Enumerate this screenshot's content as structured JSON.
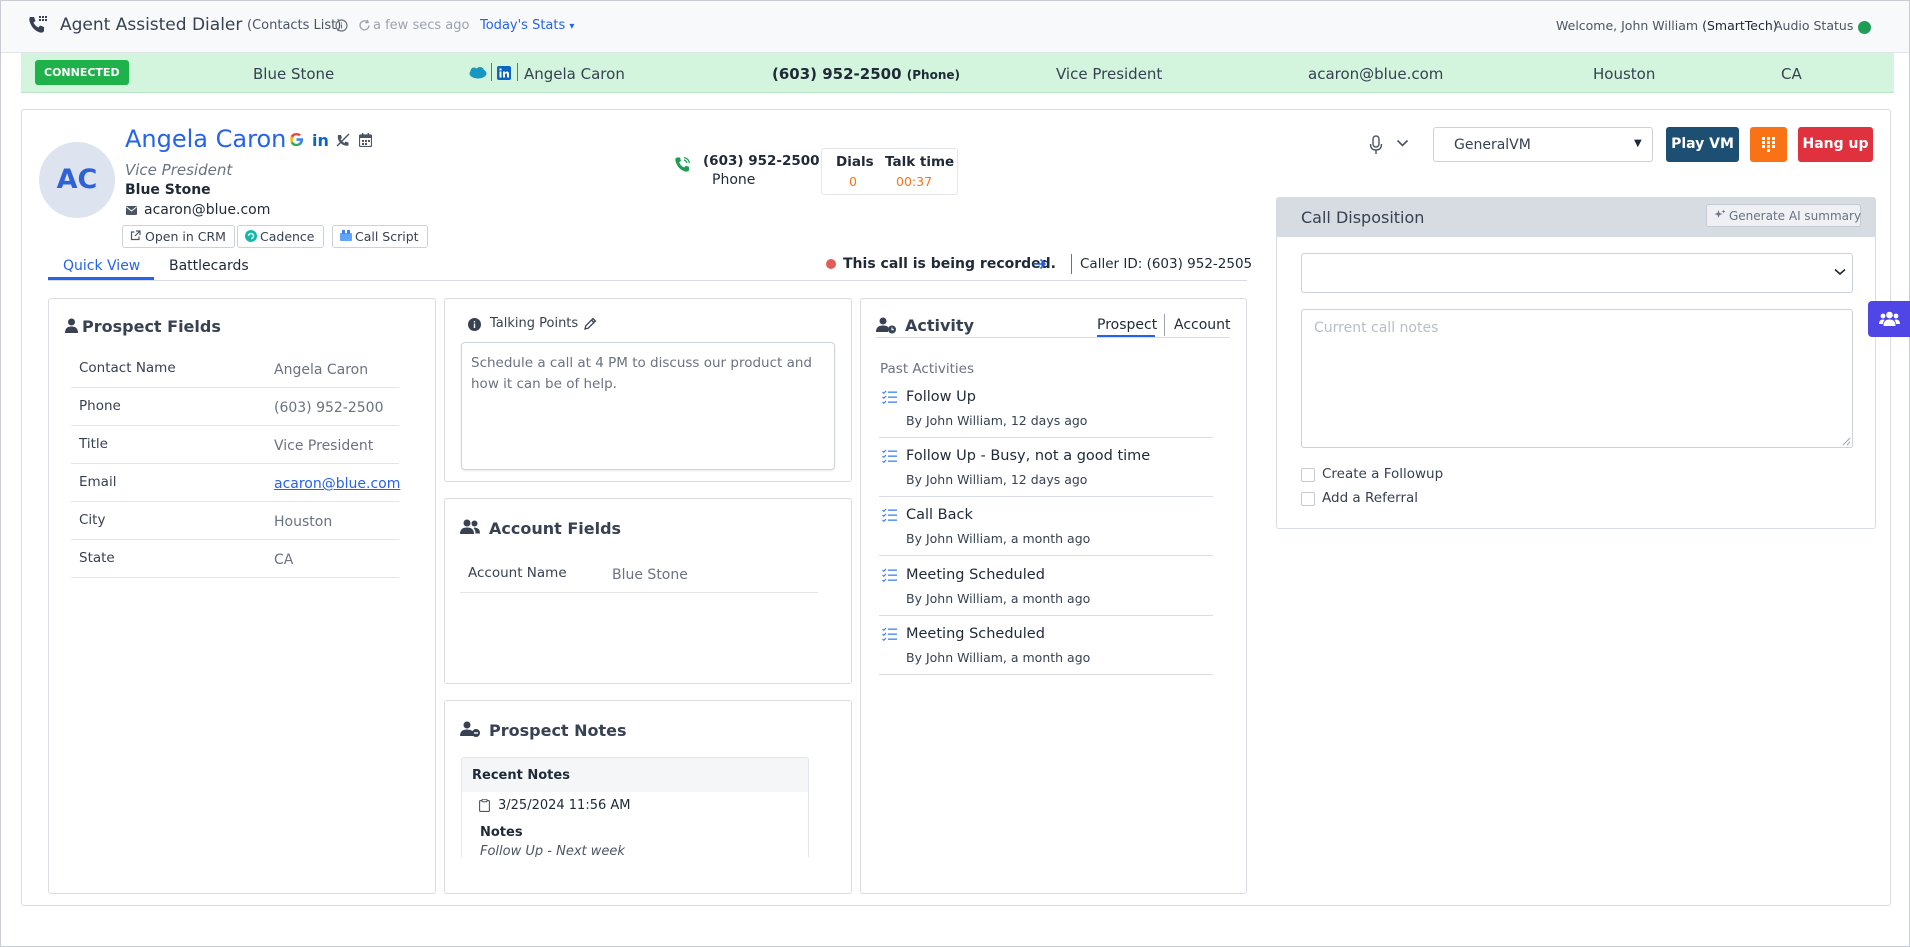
{
  "header": {
    "app_title": "Agent Assisted Dialer",
    "list_label": "(Contacts List)",
    "sync_text": "a few secs ago",
    "stats_link": "Today's Stats",
    "welcome_prefix": "Welcome, John William",
    "org": "(SmartTech)",
    "audio_status_label": "Audio Status",
    "audio_status_color": "#1f9d55"
  },
  "connection_bar": {
    "status": "CONNECTED",
    "company": "Blue Stone",
    "contact": "Angela Caron",
    "phone": "(603) 952-2500",
    "phone_type": "(Phone)",
    "title": "Vice President",
    "email": "acaron@blue.com",
    "city": "Houston",
    "state": "CA"
  },
  "prospect": {
    "initials": "AC",
    "name": "Angela Caron",
    "title": "Vice President",
    "company": "Blue Stone",
    "email": "acaron@blue.com",
    "phone": "(603) 952-2500",
    "phone_type": "Phone",
    "buttons": {
      "open_crm": "Open in CRM",
      "cadence": "Cadence",
      "call_script": "Call Script"
    }
  },
  "call_stats": {
    "dials_label": "Dials",
    "dials_value": "0",
    "talk_label": "Talk time",
    "talk_value": "00:37"
  },
  "controls": {
    "voicemail_select": "GeneralVM",
    "play_vm": "Play VM",
    "hang_up": "Hang up"
  },
  "tabs": {
    "quick_view": "Quick View",
    "battlecards": "Battlecards"
  },
  "recording": {
    "text": "This call is being recorded.",
    "caller_id": "Caller ID: (603) 952-2505"
  },
  "prospect_fields": {
    "heading": "Prospect Fields",
    "rows": [
      {
        "label": "Contact Name",
        "value": "Angela Caron"
      },
      {
        "label": "Phone",
        "value": "(603) 952-2500"
      },
      {
        "label": "Title",
        "value": "Vice President"
      },
      {
        "label": "Email",
        "value": "acaron@blue.com"
      },
      {
        "label": "City",
        "value": "Houston"
      },
      {
        "label": "State",
        "value": "CA"
      }
    ]
  },
  "talking_points": {
    "heading": "Talking Points",
    "text": "Schedule a call at 4 PM to discuss our product and how it can be of help."
  },
  "account_fields": {
    "heading": "Account Fields",
    "rows": [
      {
        "label": "Account Name",
        "value": "Blue Stone"
      }
    ]
  },
  "prospect_notes": {
    "heading": "Prospect Notes",
    "recent_label": "Recent Notes",
    "date": "3/25/2024 11:56 AM",
    "notes_label": "Notes",
    "notes_text": "Follow Up - Next week"
  },
  "activity": {
    "heading": "Activity",
    "tab_prospect": "Prospect",
    "tab_account": "Account",
    "past_label": "Past Activities",
    "items": [
      {
        "title": "Follow Up",
        "meta": "By John William, 12 days ago"
      },
      {
        "title": "Follow Up - Busy, not a good time",
        "meta": "By John William, 12 days ago"
      },
      {
        "title": "Call Back",
        "meta": "By John William, a month ago"
      },
      {
        "title": "Meeting Scheduled",
        "meta": "By John William, a month ago"
      },
      {
        "title": "Meeting Scheduled",
        "meta": "By John William, a month ago"
      }
    ]
  },
  "disposition": {
    "heading": "Call Disposition",
    "ai_button": "Generate AI summary",
    "select_value": "",
    "notes_placeholder": "Current call notes",
    "followup_label": "Create a Followup",
    "referral_label": "Add a Referral"
  },
  "colors": {
    "accent": "#2563eb",
    "connected": "#1fb24a",
    "play_vm": "#1d4f73",
    "dialpad": "#f97316",
    "hang_up": "#e0313f"
  }
}
